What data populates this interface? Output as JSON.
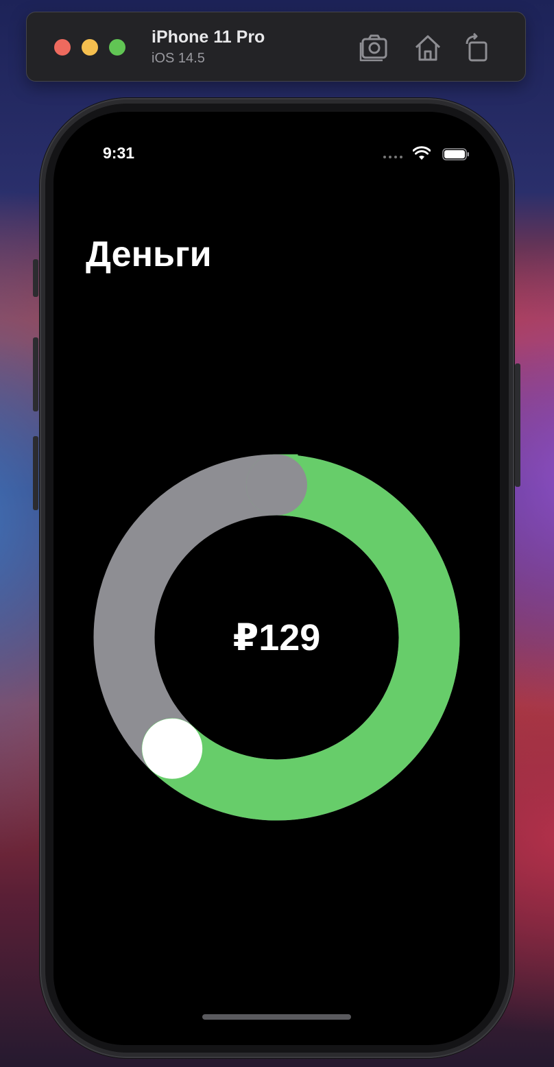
{
  "simulator": {
    "device_name": "iPhone 11 Pro",
    "os_version": "iOS 14.5",
    "toolbar_icons": [
      "screenshot-icon",
      "home-icon",
      "rotate-icon"
    ]
  },
  "status_bar": {
    "time": "9:31",
    "icons": [
      "cellular-signal-icon",
      "wifi-icon",
      "battery-icon"
    ]
  },
  "screen": {
    "title": "Деньги",
    "dial": {
      "amount_text": "₽129",
      "progress_fraction": 0.62,
      "colors": {
        "track": "#8e8e93",
        "progress": "#67cd6a",
        "knob": "#ffffff",
        "background": "#000000"
      }
    }
  }
}
